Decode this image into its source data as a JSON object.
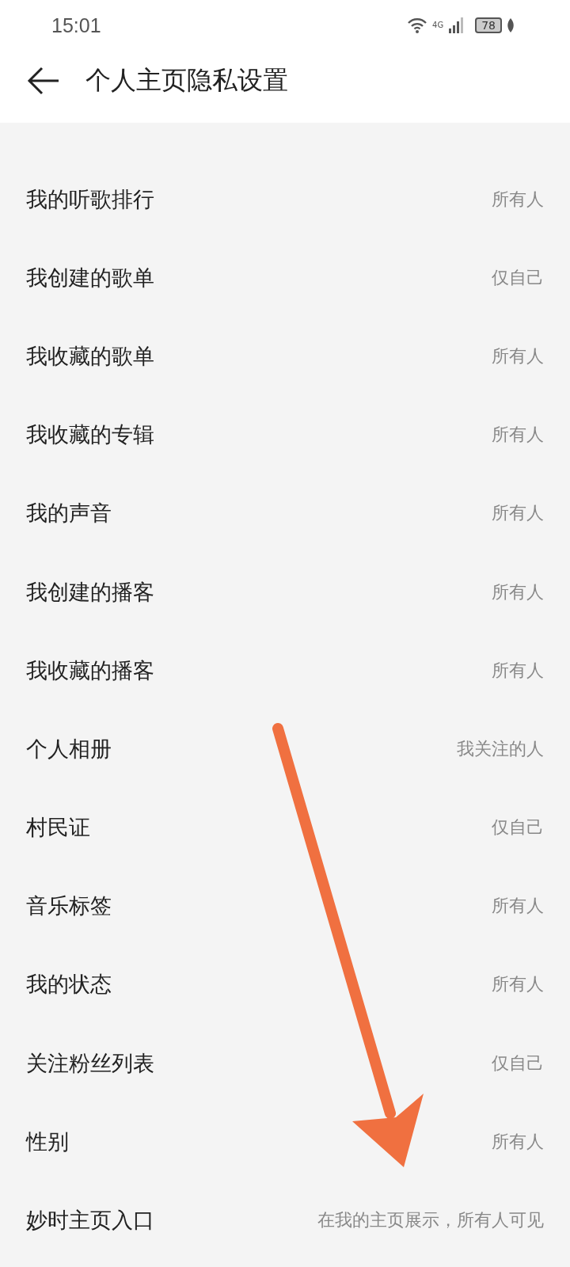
{
  "status_bar": {
    "time": "15:01",
    "network": "4G",
    "battery": "78"
  },
  "header": {
    "title": "个人主页隐私设置"
  },
  "settings": [
    {
      "label": "我的听歌排行",
      "value": "所有人"
    },
    {
      "label": "我创建的歌单",
      "value": "仅自己"
    },
    {
      "label": "我收藏的歌单",
      "value": "所有人"
    },
    {
      "label": "我收藏的专辑",
      "value": "所有人"
    },
    {
      "label": "我的声音",
      "value": "所有人"
    },
    {
      "label": "我创建的播客",
      "value": "所有人"
    },
    {
      "label": "我收藏的播客",
      "value": "所有人"
    },
    {
      "label": "个人相册",
      "value": "我关注的人"
    },
    {
      "label": "村民证",
      "value": "仅自己"
    },
    {
      "label": "音乐标签",
      "value": "所有人"
    },
    {
      "label": "我的状态",
      "value": "所有人"
    },
    {
      "label": "关注粉丝列表",
      "value": "仅自己"
    },
    {
      "label": "性别",
      "value": "所有人"
    },
    {
      "label": "妙时主页入口",
      "value": "在我的主页展示，所有人可见"
    }
  ]
}
